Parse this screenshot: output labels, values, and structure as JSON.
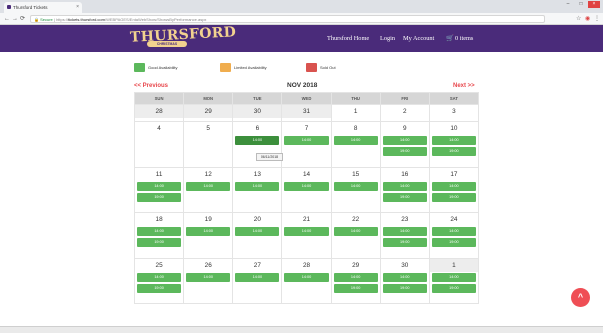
{
  "browser": {
    "tab_title": "Thursford Tickets",
    "tab_close": "×",
    "url_secure": "Secure",
    "url_host": "tickets.thursford.com",
    "url_path": "/WEBPAGES/EntaWebShow/ShowsByPerformance.aspx",
    "window_controls": [
      "–",
      "□",
      "×"
    ],
    "nav_icons": [
      "back-icon",
      "forward-icon",
      "reload-icon"
    ]
  },
  "header": {
    "logo": "THURSFORD",
    "logo_sub": "CHRISTMAS SPECTACULAR",
    "nav": [
      "Thursford Home",
      "Login",
      "My Account"
    ],
    "basket": "0 items",
    "colors": {
      "header_bg": "#4a2b7a",
      "logo": "#f2d28f"
    }
  },
  "legend": [
    {
      "label": "Good Availability",
      "color": "#5cb85c"
    },
    {
      "label": "Limited Availability",
      "color": "#f0ad4e"
    },
    {
      "label": "Sold Out",
      "color": "#d9534f"
    }
  ],
  "calendar": {
    "prev": "<< Previous",
    "next": "Next >>",
    "month": "NOV 2018",
    "days": [
      "SUN",
      "MON",
      "TUE",
      "WED",
      "THU",
      "FRI",
      "SAT"
    ],
    "weeks": [
      [
        {
          "d": "28",
          "gray": true,
          "slots": []
        },
        {
          "d": "29",
          "gray": true,
          "slots": []
        },
        {
          "d": "30",
          "gray": true,
          "slots": []
        },
        {
          "d": "31",
          "gray": true,
          "slots": []
        },
        {
          "d": "1",
          "gray": false,
          "slots": []
        },
        {
          "d": "2",
          "gray": false,
          "slots": []
        },
        {
          "d": "3",
          "gray": false,
          "slots": []
        }
      ],
      [
        {
          "d": "4",
          "gray": false,
          "slots": []
        },
        {
          "d": "5",
          "gray": false,
          "slots": []
        },
        {
          "d": "6",
          "gray": false,
          "slots": [
            "14:00"
          ],
          "selected": true
        },
        {
          "d": "7",
          "gray": false,
          "slots": [
            "14:00"
          ]
        },
        {
          "d": "8",
          "gray": false,
          "slots": [
            "14:00"
          ]
        },
        {
          "d": "9",
          "gray": false,
          "slots": [
            "14:00",
            "19:00"
          ]
        },
        {
          "d": "10",
          "gray": false,
          "slots": [
            "14:00",
            "19:00"
          ]
        }
      ],
      [
        {
          "d": "11",
          "gray": false,
          "slots": [
            "14:00",
            "19:00"
          ]
        },
        {
          "d": "12",
          "gray": false,
          "slots": [
            "14:00"
          ]
        },
        {
          "d": "13",
          "gray": false,
          "slots": [
            "14:00"
          ]
        },
        {
          "d": "14",
          "gray": false,
          "slots": [
            "14:00"
          ]
        },
        {
          "d": "15",
          "gray": false,
          "slots": [
            "14:00"
          ]
        },
        {
          "d": "16",
          "gray": false,
          "slots": [
            "14:00",
            "19:00"
          ]
        },
        {
          "d": "17",
          "gray": false,
          "slots": [
            "14:00",
            "19:00"
          ]
        }
      ],
      [
        {
          "d": "18",
          "gray": false,
          "slots": [
            "14:00",
            "19:00"
          ]
        },
        {
          "d": "19",
          "gray": false,
          "slots": [
            "14:00"
          ]
        },
        {
          "d": "20",
          "gray": false,
          "slots": [
            "14:00"
          ]
        },
        {
          "d": "21",
          "gray": false,
          "slots": [
            "14:00"
          ]
        },
        {
          "d": "22",
          "gray": false,
          "slots": [
            "14:00"
          ]
        },
        {
          "d": "23",
          "gray": false,
          "slots": [
            "14:00",
            "19:00"
          ]
        },
        {
          "d": "24",
          "gray": false,
          "slots": [
            "14:00",
            "19:00"
          ]
        }
      ],
      [
        {
          "d": "25",
          "gray": false,
          "slots": [
            "14:00",
            "19:00"
          ]
        },
        {
          "d": "26",
          "gray": false,
          "slots": [
            "14:00"
          ]
        },
        {
          "d": "27",
          "gray": false,
          "slots": [
            "14:00"
          ]
        },
        {
          "d": "28",
          "gray": false,
          "slots": [
            "14:00"
          ]
        },
        {
          "d": "29",
          "gray": false,
          "slots": [
            "14:00",
            "19:00"
          ]
        },
        {
          "d": "30",
          "gray": false,
          "slots": [
            "14:00",
            "19:00"
          ]
        },
        {
          "d": "1",
          "gray": true,
          "slots": [
            "14:00",
            "19:00"
          ]
        }
      ]
    ],
    "tooltip": "06/11/2018"
  },
  "scroll_top": "^"
}
